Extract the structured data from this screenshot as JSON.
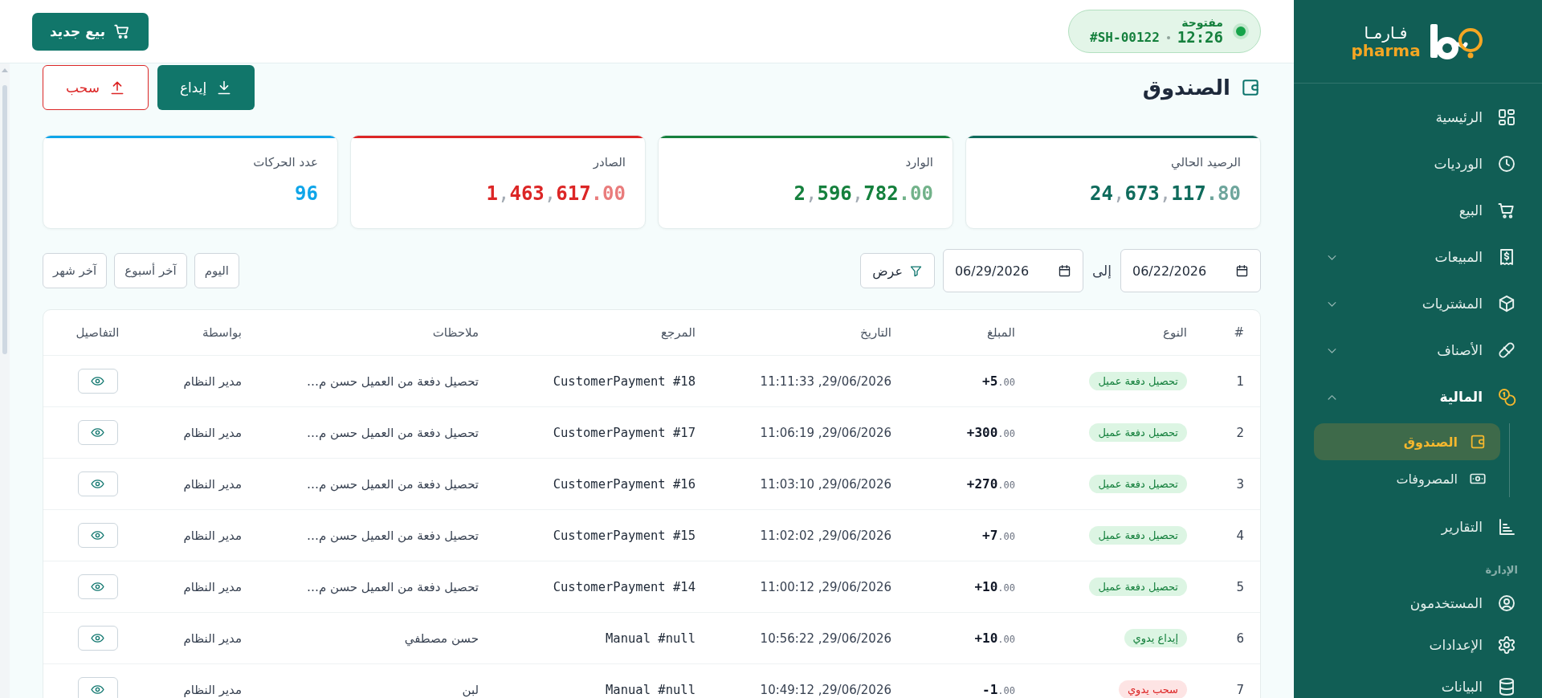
{
  "sidebar": {
    "logo": {
      "arabic": "فـارمـا",
      "latin": "pharma"
    },
    "sections": [
      {
        "items": [
          {
            "label": "الرئيسية",
            "kind": "link",
            "selected": false
          },
          {
            "label": "الورديات",
            "kind": "link",
            "selected": false
          },
          {
            "label": "البيع",
            "kind": "link",
            "selected": false
          },
          {
            "label": "المبيعات",
            "kind": "group",
            "selected": false,
            "expanded": false
          },
          {
            "label": "المشتريات",
            "kind": "group",
            "selected": false,
            "expanded": false
          },
          {
            "label": "الأصناف",
            "kind": "group",
            "selected": false,
            "expanded": false
          },
          {
            "label": "المالية",
            "kind": "group",
            "selected": true,
            "expanded": true,
            "children": [
              {
                "label": "الصندوق",
                "selected": true
              },
              {
                "label": "المصروفات",
                "selected": false
              }
            ]
          },
          {
            "label": "التقارير",
            "kind": "link",
            "selected": false
          }
        ]
      },
      {
        "title": "الإدارة",
        "items": [
          {
            "label": "المستخدمون",
            "kind": "link",
            "selected": false
          },
          {
            "label": "الإعدادات",
            "kind": "link",
            "selected": false
          },
          {
            "label": "البيانات",
            "kind": "link",
            "selected": false
          }
        ]
      }
    ]
  },
  "header": {
    "new_sale_button": "بيع جديد",
    "shift": {
      "status": "مفتوحة",
      "open": true,
      "time": "12:26",
      "number": "#SH-00122"
    }
  },
  "page": {
    "title": "الصندوق",
    "actions": [
      {
        "label": "إيداع",
        "kind": "primary"
      },
      {
        "label": "سحب",
        "kind": "danger"
      }
    ]
  },
  "stats": [
    {
      "label": "الرصيد الحالي",
      "value": "24,673,117.80",
      "color": "#0f6b5c"
    },
    {
      "label": "الوارد",
      "value": "2,596,782.00",
      "color": "#15803d"
    },
    {
      "label": "الصادر",
      "value": "1,463,617.00",
      "color": "#dc2626"
    },
    {
      "label": "عدد الحركات",
      "value": "96",
      "color": "#0ea5e9"
    }
  ],
  "filters": {
    "from": "06/22/2026",
    "to_label": "إلى",
    "to": "06/29/2026",
    "apply_button": "عرض",
    "quick_ranges": [
      {
        "label": "اليوم",
        "selected": false
      },
      {
        "label": "آخر أسبوع",
        "selected": false
      },
      {
        "label": "آخر شهر",
        "selected": false
      }
    ]
  },
  "table": {
    "columns": [
      "#",
      "النوع",
      "المبلغ",
      "التاريخ",
      "المرجع",
      "ملاحظات",
      "بواسطة",
      "التفاصيل"
    ],
    "rows": [
      {
        "number": "1",
        "type": {
          "label": "تحصيل دفعة عميل",
          "kind": "in"
        },
        "amount": "+5.00",
        "date": "29/06/2026, 11:11:33",
        "reference": "CustomerPayment #18",
        "notes": "تحصيل دفعة من العميل حسن م…",
        "by": "مدير النظام"
      },
      {
        "number": "2",
        "type": {
          "label": "تحصيل دفعة عميل",
          "kind": "in"
        },
        "amount": "+300.00",
        "date": "29/06/2026, 11:06:19",
        "reference": "CustomerPayment #17",
        "notes": "تحصيل دفعة من العميل حسن م…",
        "by": "مدير النظام"
      },
      {
        "number": "3",
        "type": {
          "label": "تحصيل دفعة عميل",
          "kind": "in"
        },
        "amount": "+270.00",
        "date": "29/06/2026, 11:03:10",
        "reference": "CustomerPayment #16",
        "notes": "تحصيل دفعة من العميل حسن م…",
        "by": "مدير النظام"
      },
      {
        "number": "4",
        "type": {
          "label": "تحصيل دفعة عميل",
          "kind": "in"
        },
        "amount": "+7.00",
        "date": "29/06/2026, 11:02:02",
        "reference": "CustomerPayment #15",
        "notes": "تحصيل دفعة من العميل حسن م…",
        "by": "مدير النظام"
      },
      {
        "number": "5",
        "type": {
          "label": "تحصيل دفعة عميل",
          "kind": "in"
        },
        "amount": "+10.00",
        "date": "29/06/2026, 11:00:12",
        "reference": "CustomerPayment #14",
        "notes": "تحصيل دفعة من العميل حسن م…",
        "by": "مدير النظام"
      },
      {
        "number": "6",
        "type": {
          "label": "إيداع يدوي",
          "kind": "in"
        },
        "amount": "+10.00",
        "date": "29/06/2026, 10:56:22",
        "reference": "Manual #null",
        "notes": "حسن مصطفي",
        "by": "مدير النظام"
      },
      {
        "number": "7",
        "type": {
          "label": "سحب يدوي",
          "kind": "out"
        },
        "amount": "-1.00",
        "date": "29/06/2026, 10:49:12",
        "reference": "Manual #null",
        "notes": "لبن",
        "by": "مدير النظام"
      }
    ]
  }
}
